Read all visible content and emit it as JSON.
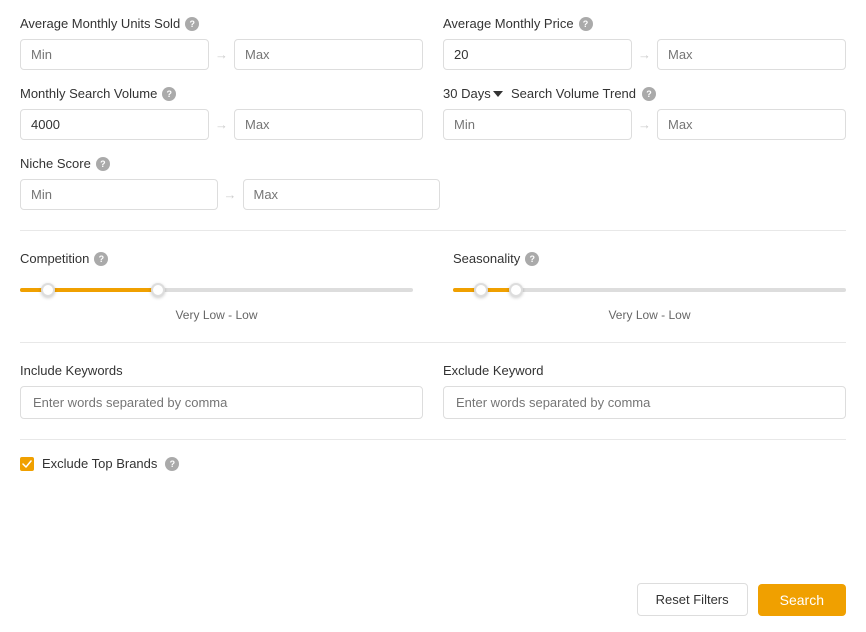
{
  "filters": {
    "avg_monthly_units": {
      "label": "Average Monthly Units Sold",
      "min_placeholder": "Min",
      "max_placeholder": "Max",
      "min_value": "",
      "max_value": ""
    },
    "avg_monthly_price": {
      "label": "Average Monthly Price",
      "min_placeholder": "20",
      "max_placeholder": "Max",
      "min_value": "20",
      "max_value": ""
    },
    "monthly_search_volume": {
      "label": "Monthly Search Volume",
      "min_placeholder": "Min",
      "max_placeholder": "Max",
      "min_value": "4000",
      "max_value": ""
    },
    "search_volume_trend": {
      "period_label": "30 Days",
      "label": "Search Volume Trend",
      "min_placeholder": "Min",
      "max_placeholder": "Max",
      "min_value": "",
      "max_value": ""
    },
    "niche_score": {
      "label": "Niche Score",
      "min_placeholder": "Min",
      "max_placeholder": "Max",
      "min_value": "",
      "max_value": ""
    },
    "competition": {
      "label": "Competition",
      "range_label": "Very Low  -  Low",
      "fill_width": "35%",
      "thumb1_pos": "7%",
      "thumb2_pos": "35%"
    },
    "seasonality": {
      "label": "Seasonality",
      "range_label": "Very Low  -  Low",
      "fill_width": "16%",
      "thumb1_pos": "7%",
      "thumb2_pos": "16%"
    },
    "include_keywords": {
      "label": "Include Keywords",
      "placeholder": "Enter words separated by comma",
      "value": ""
    },
    "exclude_keyword": {
      "label": "Exclude Keyword",
      "placeholder": "Enter words separated by comma",
      "value": ""
    },
    "exclude_top_brands": {
      "label": "Exclude Top Brands",
      "checked": true
    }
  },
  "buttons": {
    "reset_label": "Reset Filters",
    "search_label": "Search"
  }
}
